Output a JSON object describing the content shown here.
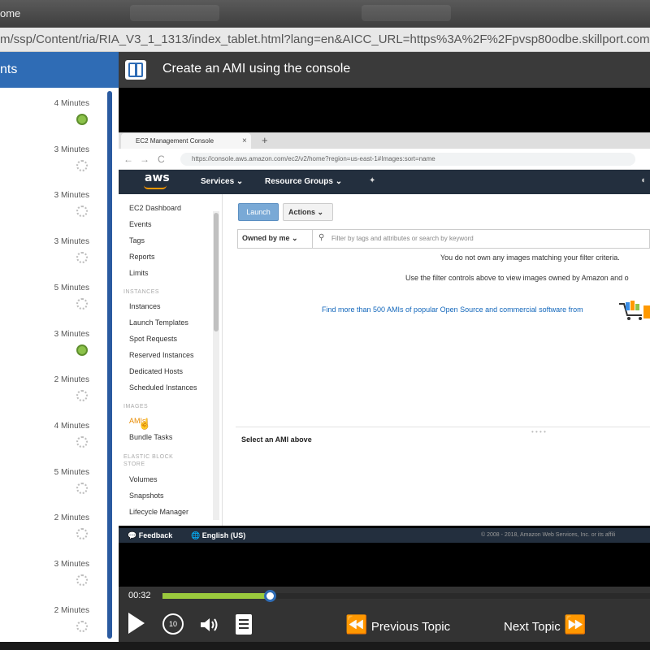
{
  "window": {
    "title_fragment": "ome"
  },
  "address_bar": {
    "url": "m/ssp/Content/ria/RIA_V3_1_1313/index_tablet.html?lang=en&AICC_URL=https%3A%2F%2Fpvsp80odbe.skillport.com"
  },
  "course": {
    "toc_title_fragment": "nts",
    "topic_title": "Create an AMI using the console"
  },
  "toc": {
    "items": [
      {
        "duration": "4 Minutes",
        "status": "complete"
      },
      {
        "duration": "3 Minutes",
        "status": "incomplete"
      },
      {
        "duration": "3 Minutes",
        "status": "incomplete"
      },
      {
        "duration": "3 Minutes",
        "status": "incomplete"
      },
      {
        "duration": "5 Minutes",
        "status": "incomplete"
      },
      {
        "duration": "3 Minutes",
        "status": "complete"
      },
      {
        "duration": "2 Minutes",
        "status": "incomplete"
      },
      {
        "duration": "4 Minutes",
        "status": "incomplete"
      },
      {
        "duration": "5 Minutes",
        "status": "incomplete"
      },
      {
        "duration": "2 Minutes",
        "status": "incomplete"
      },
      {
        "duration": "3 Minutes",
        "status": "incomplete"
      },
      {
        "duration": "2 Minutes",
        "status": "incomplete"
      }
    ]
  },
  "video_browser": {
    "tab_title": "EC2 Management Console",
    "tab_close": "×",
    "new_tab": "+",
    "url": "https://console.aws.amazon.com/ec2/v2/home?region=us-east-1#Images:sort=name",
    "back": "←",
    "forward": "→",
    "reload": "C"
  },
  "aws": {
    "logo": "aws",
    "menu": {
      "services": "Services ⌄",
      "resource_groups": "Resource Groups ⌄"
    },
    "nav": {
      "links_top": [
        "EC2 Dashboard",
        "Events",
        "Tags",
        "Reports",
        "Limits"
      ],
      "section_instances": "INSTANCES",
      "links_instances": [
        "Instances",
        "Launch Templates",
        "Spot Requests",
        "Reserved Instances",
        "Dedicated Hosts",
        "Scheduled Instances"
      ],
      "section_images": "IMAGES",
      "links_images": [
        "AMIs",
        "Bundle Tasks"
      ],
      "section_ebs_1": "ELASTIC BLOCK",
      "section_ebs_2": "STORE",
      "links_ebs": [
        "Volumes",
        "Snapshots",
        "Lifecycle Manager"
      ]
    },
    "launch": "Launch",
    "actions": "Actions ⌄",
    "owned_by": "Owned by me ⌄",
    "filter_placeholder": "Filter by tags and attributes or search by keyword",
    "msg_none": "You do not own any images matching your filter criteria.",
    "msg_controls": "Use the filter controls above to view images owned by Amazon and o",
    "msg_marketplace": "Find more than 500 AMIs of popular Open Source and commercial software from",
    "select_ami": "Select an AMI above",
    "footer_feedback": "Feedback",
    "footer_lang": "English (US)",
    "footer_copyright": "© 2008 - 2018, Amazon Web Services, Inc. or its affili"
  },
  "player": {
    "elapsed": "00:32",
    "progress": 0.22,
    "replay_seconds": "10",
    "previous_topic": "Previous Topic",
    "next_topic": "Next Topic"
  },
  "colors": {
    "accent": "#2f6cb5",
    "progress": "#9ac93d",
    "aws_dark": "#232f3e",
    "aws_orange": "#ff9900"
  }
}
